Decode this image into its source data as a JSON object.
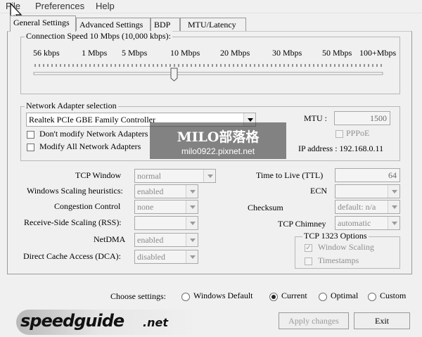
{
  "menu": {
    "file": "File",
    "preferences": "Preferences",
    "help": "Help"
  },
  "tabs": [
    "General Settings",
    "Advanced Settings",
    "BDP",
    "MTU/Latency"
  ],
  "connection_speed": {
    "label": "Connection Speed  10 Mbps (10,000 kbps):",
    "ticks": [
      "56 kbps",
      "1 Mbps",
      "5 Mbps",
      "10 Mbps",
      "20 Mbps",
      "30 Mbps",
      "50 Mbps",
      "100+Mbps"
    ],
    "selected": "10 Mbps"
  },
  "network_adapter": {
    "group_label": "Network Adapter selection",
    "adapter": "Realtek PCIe GBE Family Controller",
    "dont_modify": "Don't modify Network Adapters",
    "modify_all": "Modify All Network Adapters",
    "mtu_label": "MTU :",
    "mtu_value": "1500",
    "pppoe": "PPPoE",
    "ip_address": "IP address : 192.168.0.11"
  },
  "watermark": {
    "title": "MILO部落格",
    "url": "milo0922.pixnet.net"
  },
  "left_settings": [
    {
      "label": "TCP Window",
      "value": "normal",
      "enabled": false
    },
    {
      "label": "Windows Scaling heuristics:",
      "value": "enabled",
      "enabled": false
    },
    {
      "label": "Congestion Control",
      "value": "none",
      "enabled": false
    },
    {
      "label": "Receive-Side Scaling (RSS):",
      "value": "",
      "enabled": false
    },
    {
      "label": "NetDMA",
      "value": "enabled",
      "enabled": false
    },
    {
      "label": "Direct Cache Access (DCA):",
      "value": "disabled",
      "enabled": false
    }
  ],
  "right_settings": {
    "ttl_label": "Time to Live (TTL)",
    "ttl_value": "64",
    "ecn_label": "ECN",
    "ecn_value": "",
    "checksum_label": "Checksum",
    "checksum_value": "default: n/a",
    "chimney_label": "TCP Chimney",
    "chimney_value": "automatic",
    "tcp1323_label": "TCP 1323 Options",
    "window_scaling": "Window Scaling",
    "timestamps": "Timestamps"
  },
  "choose": {
    "label": "Choose settings:",
    "options": [
      "Windows Default",
      "Current",
      "Optimal",
      "Custom"
    ],
    "selected": "Current"
  },
  "logo": {
    "text": "speedguide",
    "suffix": ".net"
  },
  "buttons": {
    "apply": "Apply changes",
    "exit": "Exit"
  }
}
